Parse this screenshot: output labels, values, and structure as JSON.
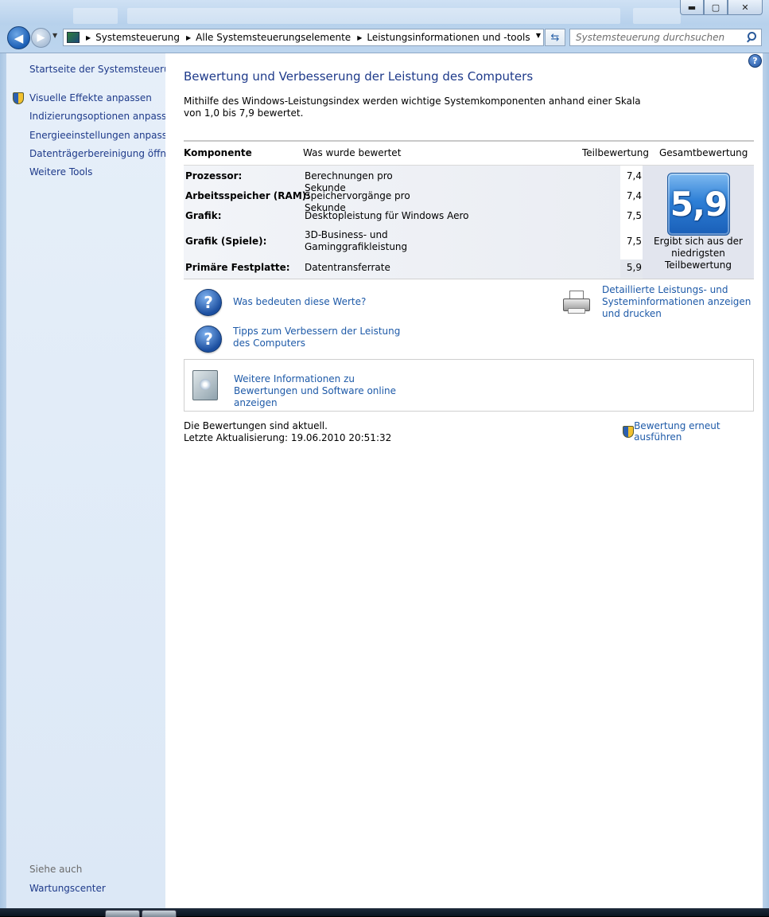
{
  "address_bar": {
    "breadcrumbs": [
      "Systemsteuerung",
      "Alle Systemsteuerungselemente",
      "Leistungsinformationen und -tools"
    ]
  },
  "search": {
    "placeholder": "Systemsteuerung durchsuchen"
  },
  "window_buttons": {
    "minimize": "▬",
    "maximize": "▢",
    "close": "✕"
  },
  "sidebar": {
    "home_link": "Startseite der Systemsteuerung",
    "tasks": [
      {
        "label": "Visuelle Effekte anpassen",
        "icon": "shield-icon"
      },
      {
        "label": "Indizierungsoptionen anpassen"
      },
      {
        "label": "Energieeinstellungen anpassen"
      },
      {
        "label": "Datenträgerbereinigung öffnen"
      },
      {
        "label": "Weitere Tools"
      }
    ],
    "see_also_label": "Siehe auch",
    "see_also_links": [
      "Wartungscenter"
    ]
  },
  "main": {
    "title": "Bewertung und Verbesserung der Leistung des Computers",
    "intro": "Mithilfe des Windows-Leistungsindex werden wichtige Systemkomponenten anhand einer Skala von 1,0 bis 7,9 bewertet.",
    "table": {
      "headers": {
        "component": "Komponente",
        "what": "Was wurde bewertet",
        "subscore": "Teilbewertung",
        "basescore": "Gesamtbewertung"
      },
      "rows": [
        {
          "component": "Prozessor:",
          "what": "Berechnungen pro Sekunde",
          "score": "7,4"
        },
        {
          "component": "Arbeitsspeicher (RAM):",
          "what": "Speichervorgänge pro Sekunde",
          "score": "7,4"
        },
        {
          "component": "Grafik:",
          "what": "Desktopleistung für Windows Aero",
          "score": "7,5"
        },
        {
          "component": "Grafik (Spiele):",
          "what": "3D-Business- und Gaminggrafikleistung",
          "score": "7,5"
        },
        {
          "component": "Primäre Festplatte:",
          "what": "Datentransferrate",
          "score": "5,9"
        }
      ],
      "base_score": "5,9",
      "base_caption": "Ergibt sich aus der niedrigsten Teilbewertung"
    },
    "links": {
      "what_mean": "Was bedeuten diese Werte?",
      "tips": "Tipps zum Verbessern der Leistung des Computers",
      "detailed": "Detaillierte Leistungs- und Systeminformationen anzeigen und drucken",
      "online": "Weitere Informationen zu Bewertungen und Software online anzeigen"
    },
    "status_line1": "Die Bewertungen sind aktuell.",
    "status_line2": "Letzte Aktualisierung: 19.06.2010 20:51:32",
    "rerun": "Bewertung erneut ausführen"
  }
}
